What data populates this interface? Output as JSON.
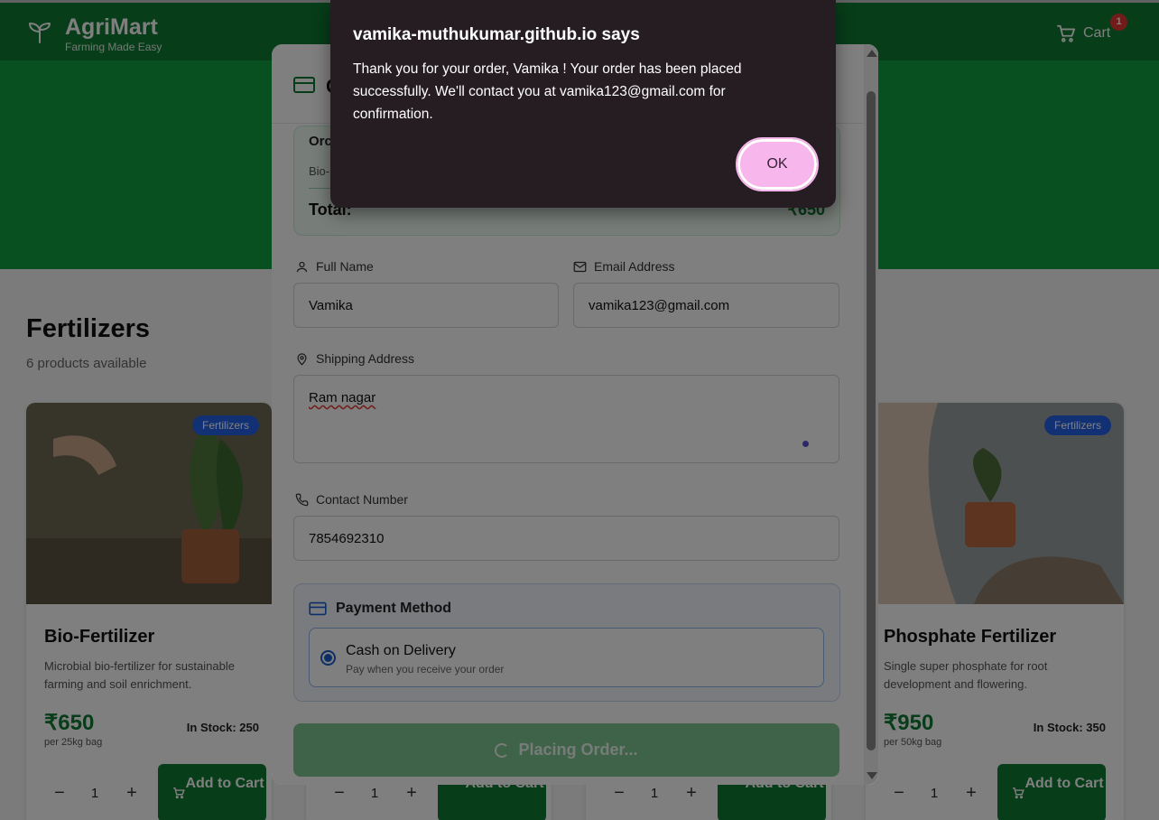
{
  "app": {
    "name": "AgriMart",
    "tagline": "Farming Made Easy",
    "cart_label": "Cart",
    "cart_count": "1",
    "brand_color": "#0f7a33"
  },
  "section": {
    "title": "Fertilizers",
    "subtitle": "6 products available"
  },
  "products": [
    {
      "category": "Fertilizers",
      "name": "Bio-Fertilizer",
      "description": "Microbial bio-fertilizer for sustainable farming and soil enrichment.",
      "price": "₹650",
      "unit": "per 25kg bag",
      "stock": "In Stock: 250",
      "quantity": "1",
      "add_label": "Add to Cart"
    },
    {
      "category": "Fertilizers",
      "name": "Phosphate Fertilizer",
      "description": "Single super phosphate for root development and flowering.",
      "price": "₹950",
      "unit": "per 50kg bag",
      "stock": "In Stock: 350",
      "quantity": "1",
      "add_label": "Add to Cart"
    }
  ],
  "hidden_cards": {
    "quantity": "1",
    "add_label": "Add to Cart"
  },
  "checkout": {
    "title_initial": "C",
    "summary_title": "Orc",
    "summary_item": "Bio-",
    "total_label": "Total:",
    "total_value": "₹650",
    "full_name_label": "Full Name",
    "full_name_value": "Vamika",
    "email_label": "Email Address",
    "email_value": "vamika123@gmail.com",
    "address_label": "Shipping Address",
    "address_value": "Ram nagar",
    "contact_label": "Contact Number",
    "contact_value": "7854692310",
    "payment_title": "Payment Method",
    "payment_option": "Cash on Delivery",
    "payment_desc": "Pay when you receive your order",
    "place_label": "Placing Order..."
  },
  "alert": {
    "origin": "vamika-muthukumar.github.io says",
    "message": "Thank you for your order, Vamika ! Your order has been placed successfully. We'll contact you at vamika123@gmail.com for confirmation.",
    "ok_label": "OK"
  }
}
